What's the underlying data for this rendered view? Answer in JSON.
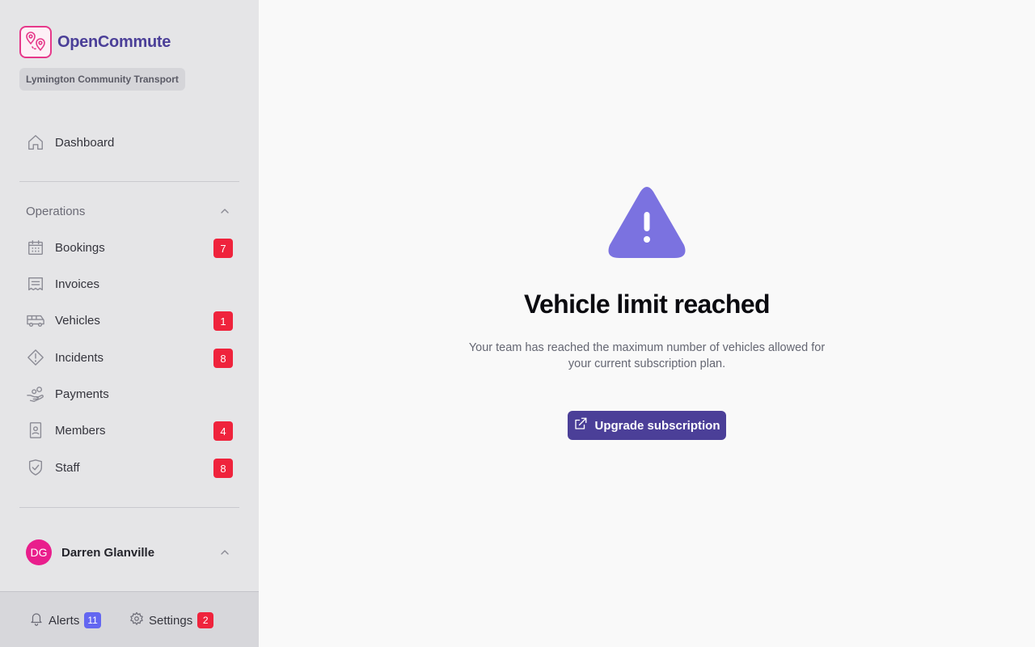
{
  "brand": {
    "name": "OpenCommute",
    "organization": "Lymington Community Transport",
    "accent": "#4b3f98",
    "logo_color": "#e6388a"
  },
  "nav": {
    "dashboard": {
      "label": "Dashboard",
      "icon": "home-icon"
    },
    "section": {
      "label": "Operations",
      "icon": "chevron-up-icon"
    },
    "items": [
      {
        "label": "Bookings",
        "icon": "calendar-icon",
        "badge": "7"
      },
      {
        "label": "Invoices",
        "icon": "receipt-icon",
        "badge": ""
      },
      {
        "label": "Vehicles",
        "icon": "bus-icon",
        "badge": "1"
      },
      {
        "label": "Incidents",
        "icon": "warning-diamond-icon",
        "badge": "8"
      },
      {
        "label": "Payments",
        "icon": "hand-coins-icon",
        "badge": ""
      },
      {
        "label": "Members",
        "icon": "id-badge-icon",
        "badge": "4"
      },
      {
        "label": "Staff",
        "icon": "shield-check-icon",
        "badge": "8"
      }
    ]
  },
  "user": {
    "initials": "DG",
    "name": "Darren Glanville",
    "avatar_color": "#e91e8c"
  },
  "footer": {
    "alerts": {
      "label": "Alerts",
      "badge": "11",
      "badge_color": "#6366f1"
    },
    "settings": {
      "label": "Settings",
      "badge": "2",
      "badge_color": "#ef233c"
    }
  },
  "main": {
    "icon": "warning-triangle-icon",
    "icon_color": "#7b72e0",
    "title": "Vehicle limit reached",
    "description_line1": "Your team has reached the maximum number of vehicles allowed for",
    "description_line2": "your current subscription plan.",
    "button_label": "Upgrade subscription",
    "button_icon": "external-link-icon"
  }
}
